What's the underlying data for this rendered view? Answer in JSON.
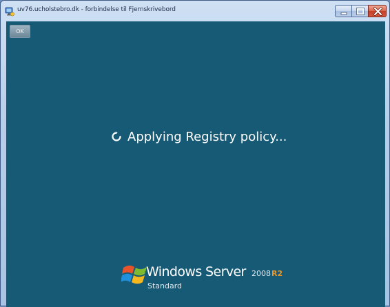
{
  "window": {
    "title": "uv76.ucholstebro.dk - forbindelse til Fjernskrivebord"
  },
  "session": {
    "ok_label": "OK",
    "status_text": "Applying Registry policy..."
  },
  "branding": {
    "product": "Windows Server",
    "version": "2008",
    "release": "R2",
    "edition": "Standard"
  },
  "colors": {
    "desktop_background": "#175a75",
    "status_text": "#ffffff",
    "release_accent": "#e8962b"
  },
  "icons": {
    "app": "remote-desktop-icon",
    "spinner": "loading-spinner-icon",
    "logo": "windows-flag-logo",
    "minimize": "minimize-icon",
    "maximize": "maximize-icon",
    "close": "close-icon"
  }
}
